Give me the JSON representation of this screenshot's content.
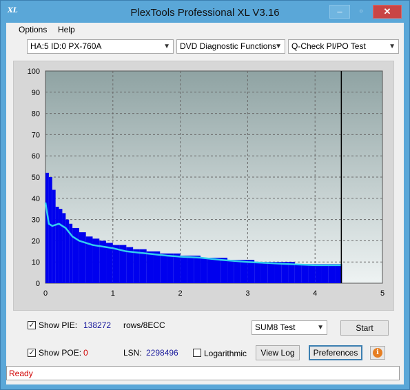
{
  "window": {
    "title": "PlexTools Professional XL V3.16",
    "icon_text": "XL"
  },
  "menu": {
    "items": [
      "Options",
      "Help"
    ]
  },
  "toolbar": {
    "drive": "HA:5 ID:0  PX-760A",
    "function": "DVD Diagnostic Functions",
    "test": "Q-Check PI/PO Test"
  },
  "chart_data": {
    "type": "bar",
    "title": "",
    "xlabel": "",
    "ylabel": "",
    "xlim": [
      0,
      5
    ],
    "ylim": [
      0,
      100
    ],
    "xticks": [
      "0",
      "1",
      "2",
      "3",
      "4",
      "5"
    ],
    "yticks": [
      "0",
      "10",
      "20",
      "30",
      "40",
      "50",
      "60",
      "70",
      "80",
      "90",
      "100"
    ],
    "grid": true,
    "marker_x": 4.39,
    "series": [
      {
        "kind": "bar",
        "color": "#0000ee",
        "x": [
          0.0,
          0.05,
          0.1,
          0.15,
          0.2,
          0.25,
          0.3,
          0.35,
          0.4,
          0.5,
          0.6,
          0.7,
          0.8,
          0.9,
          1.0,
          1.1,
          1.2,
          1.3,
          1.4,
          1.5,
          1.6,
          1.7,
          1.8,
          1.9,
          2.0,
          2.1,
          2.2,
          2.3,
          2.4,
          2.5,
          2.6,
          2.7,
          2.8,
          2.9,
          3.0,
          3.1,
          3.2,
          3.3,
          3.4,
          3.5,
          3.6,
          3.7,
          3.8,
          3.9,
          4.0,
          4.1,
          4.2,
          4.3,
          4.39
        ],
        "values": [
          52,
          50,
          44,
          36,
          35,
          33,
          30,
          28,
          26,
          24,
          22,
          21,
          20,
          19,
          18,
          18,
          17,
          16,
          16,
          15,
          15,
          14,
          14,
          14,
          13,
          13,
          13,
          12,
          12,
          12,
          12,
          11,
          11,
          11,
          11,
          10,
          10,
          10,
          10,
          10,
          10,
          9,
          9,
          9,
          9,
          9,
          9,
          9,
          9
        ]
      },
      {
        "kind": "line",
        "color": "#33ccee",
        "x": [
          0.0,
          0.05,
          0.1,
          0.2,
          0.3,
          0.4,
          0.5,
          0.7,
          0.9,
          1.0,
          1.2,
          1.5,
          1.8,
          2.0,
          2.3,
          2.6,
          3.0,
          3.3,
          3.6,
          4.0,
          4.2,
          4.39
        ],
        "values": [
          38,
          28,
          27,
          28,
          26,
          22,
          20,
          18,
          17,
          16.5,
          15,
          14,
          13,
          12.5,
          12,
          11,
          10,
          9.5,
          9,
          8.5,
          8.5,
          8.5
        ]
      }
    ]
  },
  "controls": {
    "show_pie_label": "Show PIE:",
    "pie_value": "138272",
    "pie_unit": "rows/8ECC",
    "show_poe_label": "Show POE:",
    "poe_value": "0",
    "lsn_label": "LSN:",
    "lsn_value": "2298496",
    "logarithmic_label": "Logarithmic",
    "test_select": "SUM8 Test",
    "start_button": "Start",
    "view_log_button": "View Log",
    "preferences_button": "Preferences",
    "check_mark": "✓"
  },
  "status": {
    "text": "Ready"
  }
}
